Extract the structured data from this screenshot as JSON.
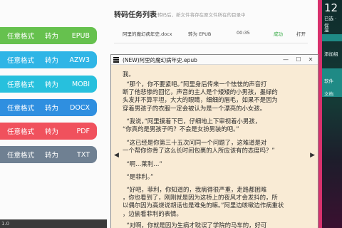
{
  "converter": {
    "buttons": [
      {
        "a": "任意格式",
        "b": "转为",
        "c": "EPUB",
        "color": "#66c14e"
      },
      {
        "a": "任意格式",
        "b": "转为",
        "c": "AZW3",
        "color": "#2fb5e6"
      },
      {
        "a": "任意格式",
        "b": "转为",
        "c": "MOBI",
        "color": "#27c0dd"
      },
      {
        "a": "任意格式",
        "b": "转为",
        "c": "DOCX",
        "color": "#2f8fe0"
      },
      {
        "a": "任意格式",
        "b": "转为",
        "c": "PDF",
        "color": "#f0515d"
      },
      {
        "a": "任意格式",
        "b": "转为",
        "c": "TXT",
        "color": "#6f8092"
      }
    ],
    "panel_title": "转码任务列表",
    "panel_hint": "转码后，新文件将存在原文件所在的目录中",
    "task": {
      "file": "阿里的魔幻病年史.docx",
      "action": "转为 EPUB",
      "time": "00:35",
      "status": "成功",
      "open": "打开",
      "status_color": "#2aa63a"
    },
    "version": "1.0"
  },
  "desktop": {
    "clock": "12",
    "lines": [
      "已选 · 保",
      "温",
      "添加组",
      "软件",
      "文档"
    ]
  },
  "reader": {
    "title": "(NEW)阿里的魔幻病年史.epub",
    "buttons": {
      "minimize": "—",
      "maximize": "☐",
      "close": "✕"
    },
    "paragraphs": [
      "我。",
      "  “那个，你不要紧吧。”阿里身后传来一个怯怯的声音打\n断了他悲惨的回忆，声音的主人是个矮矮的小男孩，墨绿的\n头发并不算平坦，大大的眼睛，细细的眉毛，如果不是因为\n穿着男孩子的衣服一定会被认为是一个漂亮的小女孩。",
      "  “我说，”阿里摸着下巴，仔细地上下审视着小男孩，\n“你真的是男孩子吗？不会是女扮男装的吧。”",
      "  “这已经是你第三十五次问同一个问题了，这难道是对\n一个帮你你骨了这么长时间包裹的人所应该有的态度吗？”",
      "  “啊…莱利…”",
      "  “是菲利。”",
      "  “好吧，菲利，你知道的，我病得很严重，走路都困难\n，你也看到了，刚刚就是因为这桥上的夜风才会发抖的，所\n以偶尔因为高烧说胡话也是难免的嘛。”阿里边咳嗽边作病重状\n，边偷看菲利的表情。",
      "  “对啊，你就是因为生病才耽误了学院的马车的，好可"
    ],
    "nav_prev": "◀",
    "nav_next": "▶"
  }
}
